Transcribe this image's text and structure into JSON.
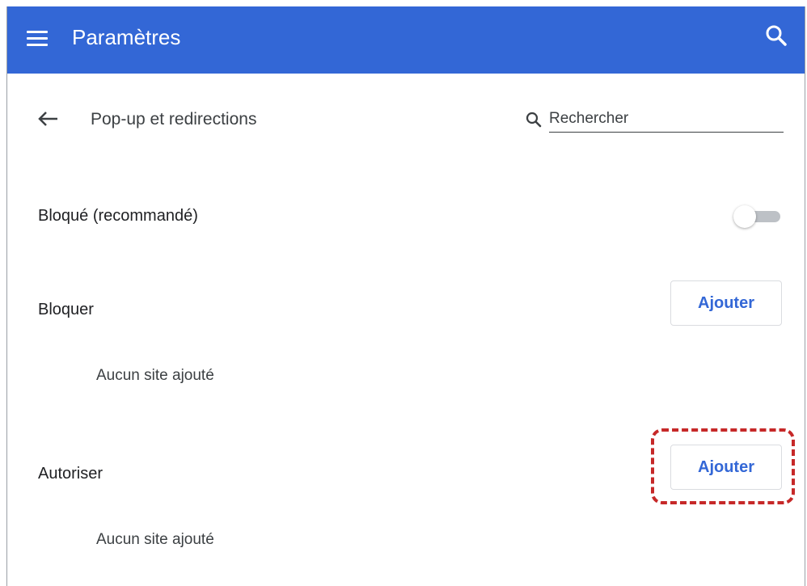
{
  "header": {
    "title": "Paramètres",
    "color": "#3367d6"
  },
  "subheader": {
    "title": "Pop-up et redirections",
    "search_placeholder": "Rechercher"
  },
  "settings": {
    "blocked_label": "Bloqué (recommandé)",
    "blocked_enabled": false,
    "block_section": {
      "label": "Bloquer",
      "add_button": "Ajouter",
      "empty_text": "Aucun site ajouté"
    },
    "allow_section": {
      "label": "Autoriser",
      "add_button": "Ajouter",
      "empty_text": "Aucun site ajouté"
    }
  },
  "icons": {
    "menu": "hamburger-menu",
    "search": "magnifier",
    "back": "arrow-left"
  },
  "colors": {
    "accent": "#3367d6",
    "highlight": "#c62828",
    "toggle_track": "#bdc1c6"
  }
}
